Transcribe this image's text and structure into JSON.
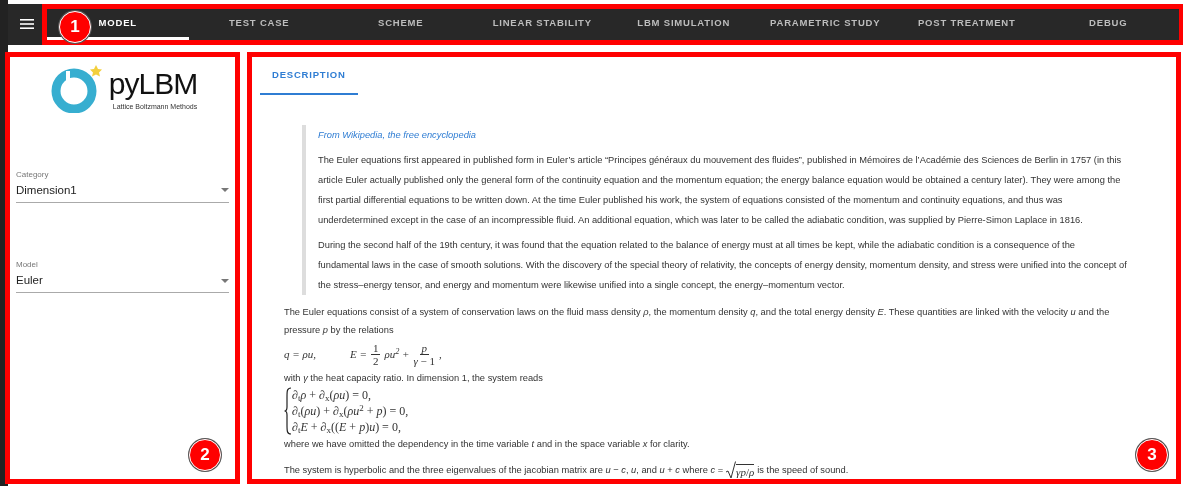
{
  "nav": {
    "badge": "1",
    "tabs": [
      {
        "label": "MODEL",
        "selected": true
      },
      {
        "label": "TEST CASE",
        "selected": false
      },
      {
        "label": "SCHEME",
        "selected": false
      },
      {
        "label": "LINEAR STABILITY",
        "selected": false
      },
      {
        "label": "LBM SIMULATION",
        "selected": false
      },
      {
        "label": "PARAMETRIC STUDY",
        "selected": false
      },
      {
        "label": "POST TREATMENT",
        "selected": false
      },
      {
        "label": "DEBUG",
        "selected": false
      }
    ]
  },
  "sidebar": {
    "badge": "2",
    "logo": {
      "text": "pyLBM",
      "tagline": "Lattice Boltzmann Methods"
    },
    "fields": [
      {
        "label": "Category",
        "value": "Dimension1"
      },
      {
        "label": "Model",
        "value": "Euler"
      }
    ]
  },
  "content": {
    "badge": "3",
    "tabs": [
      {
        "label": "DESCRIPTION",
        "selected": true
      }
    ],
    "quote": {
      "source": "From Wikipedia, the free encyclopedia",
      "paragraphs": [
        "The Euler equations first appeared in published form in Euler’s article “Principes généraux du mouvement des fluides”, published in Mémoires de l’Académie des Sciences de Berlin in 1757 (in this article Euler actually published only the general form of the continuity equation and the momentum equation; the energy balance equation would be obtained a century later). They were among the first partial differential equations to be written down. At the time Euler published his work, the system of equations consisted of the momentum and continuity equations, and thus was underdetermined except in the case of an incompressible fluid. An additional equation, which was later to be called the adiabatic condition, was supplied by Pierre-Simon Laplace in 1816.",
        "During the second half of the 19th century, it was found that the equation related to the balance of energy must at all times be kept, while the adiabatic condition is a consequence of the fundamental laws in the case of smooth solutions. With the discovery of the special theory of relativity, the concepts of energy density, momentum density, and stress were unified into the concept of the stress–energy tensor, and energy and momentum were likewise unified into a single concept, the energy–momentum vector."
      ]
    },
    "blocks": [
      {
        "kind": "para",
        "text": "The Euler equations consist of a system of conservation laws on the fluid mass density *ρ*, the momentum density *q*, and the total energy density *E*. These quantities are linked with the velocity *u* and the pressure *p* by the relations"
      },
      {
        "kind": "formula",
        "pieces": [
          {
            "kind": "math",
            "text": "*q* = *ρu*,"
          },
          {
            "kind": "math",
            "text": "*E* ="
          },
          {
            "kind": "frac",
            "num": "1",
            "den": "2"
          },
          {
            "kind": "math",
            "text": "*ρu*$^{2}$ +"
          },
          {
            "kind": "frac",
            "num": "*p*",
            "den": "*γ* − 1"
          },
          {
            "kind": "math",
            "text": ","
          }
        ]
      },
      {
        "kind": "para",
        "text": "with *γ* the heat capacity ratio. In dimension 1, the system reads"
      },
      {
        "kind": "system",
        "lines": [
          "∂$_{t}$*ρ* + ∂$_{x}$(*ρu*) = 0,",
          "∂$_{t}$(*ρu*) + ∂$_{x}$(*ρu*$^{2}$ + *p*) = 0,",
          "∂$_{t}$*E* + ∂$_{x}$((*E* + *p*)*u*) = 0,"
        ]
      },
      {
        "kind": "para",
        "text": "where we have omitted the dependency in the time variable *t* and in the space variable *x* for clarity."
      },
      {
        "kind": "sqrt_para",
        "before": "The system is hyperbolic and the three eigenvalues of the jacobian matrix are *u* − *c*, *u*, and *u* + *c* where *c* =",
        "radicand": "*γp*/*ρ*",
        "after": "is the speed of sound."
      }
    ]
  }
}
